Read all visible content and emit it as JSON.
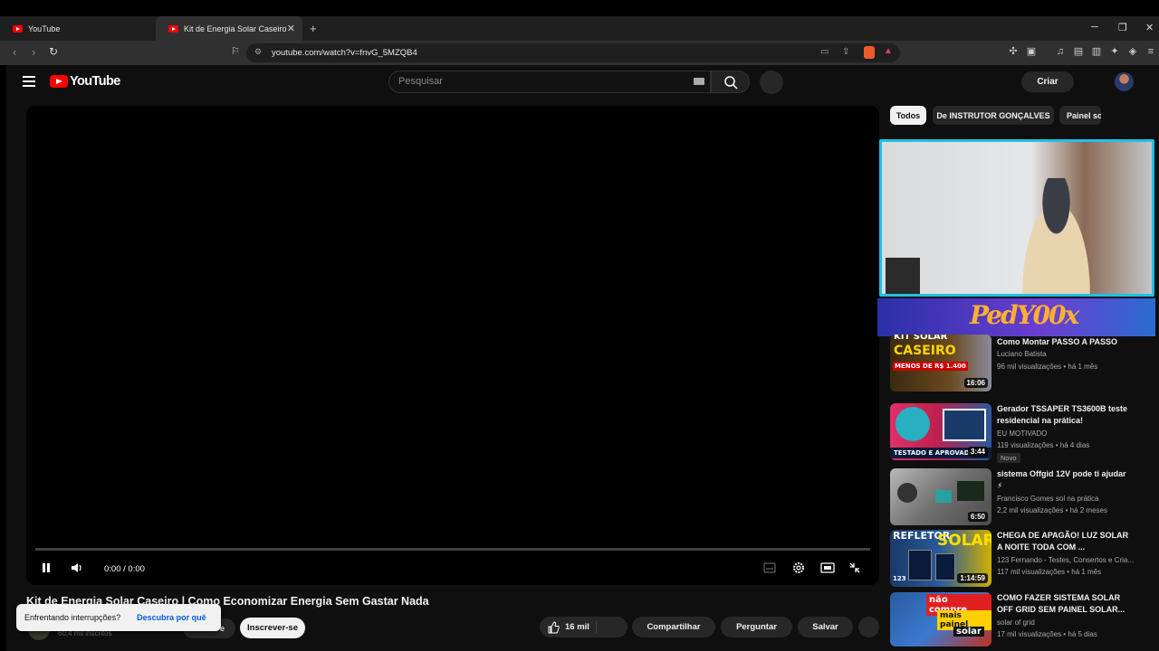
{
  "browser": {
    "tabs": [
      {
        "title": "YouTube"
      },
      {
        "title": "Kit de Energia Solar Caseiro | Co"
      }
    ],
    "url": "youtube.com/watch?v=fnvG_5MZQB4"
  },
  "header": {
    "logo_text": "YouTube",
    "search_placeholder": "Pesquisar",
    "create_label": "Criar"
  },
  "player": {
    "time": "0:00 / 0:00"
  },
  "video": {
    "title": "Kit de Energia Solar Caseiro | Como Economizar Energia Sem Gastar Nada",
    "subscribers": "60,4 mil inscritos",
    "join_label": "Seja membro",
    "join_visible": "e",
    "subscribe_label": "Inscrever-se",
    "likes": "16 mil",
    "share_label": "Compartilhar",
    "ask_label": "Perguntar",
    "save_label": "Salvar"
  },
  "toast": {
    "text": "Enfrentando interrupções?",
    "link": "Descubra por quê"
  },
  "chips": [
    "Todos",
    "De INSTRUTOR GONÇALVES",
    "Painel so"
  ],
  "overlay": {
    "banner_text": "PedY00x"
  },
  "recommendations": [
    {
      "title": "Como Montar PASSO A PASSO",
      "channel": "Luciano Batista",
      "meta": "96 mil visualizações • há 1 mês",
      "duration": "16:06",
      "thumb_text_1": "KIT SOLAR",
      "thumb_text_2": "CASEIRO",
      "thumb_text_3": "MENOS DE R$ 1.400"
    },
    {
      "title": "Gerador TSSAPER TS3600B teste residencial na prática!",
      "channel": "EU MOTIVADO",
      "meta": "119 visualizações • há 4 dias",
      "badge": "Novo",
      "duration": "3:44",
      "thumb_text_1": "TESTADO E APROVADO"
    },
    {
      "title": "sistema Offgid 12V pode ti ajudar ⚡",
      "channel": "Francisco Gomes sol na prática",
      "meta": "2,2 mil visualizações • há 2 meses",
      "duration": "6:50"
    },
    {
      "title": "CHEGA DE APAGÃO! LUZ SOLAR A NOITE TODA COM ...",
      "channel": "123 Fernando - Testes, Consertos e Cria...",
      "meta": "117 mil visualizações • há 1 mês",
      "duration": "1:14:59",
      "thumb_text_1": "REFLETOR",
      "thumb_text_2": "SOLAR",
      "thumb_text_3": "123"
    },
    {
      "title": "COMO FAZER SISTEMA SOLAR OFF GRID SEM PAINEL SOLAR...",
      "channel": "solar of grid",
      "meta": "17 mil visualizações • há 5 dias",
      "thumb_text_1": "não compre",
      "thumb_text_2": "mais painel",
      "thumb_text_3": "solar"
    }
  ],
  "colors": {
    "yt_red": "#ff0000",
    "cam_border": "#1ec0e8",
    "background": "#0f0f0f"
  }
}
